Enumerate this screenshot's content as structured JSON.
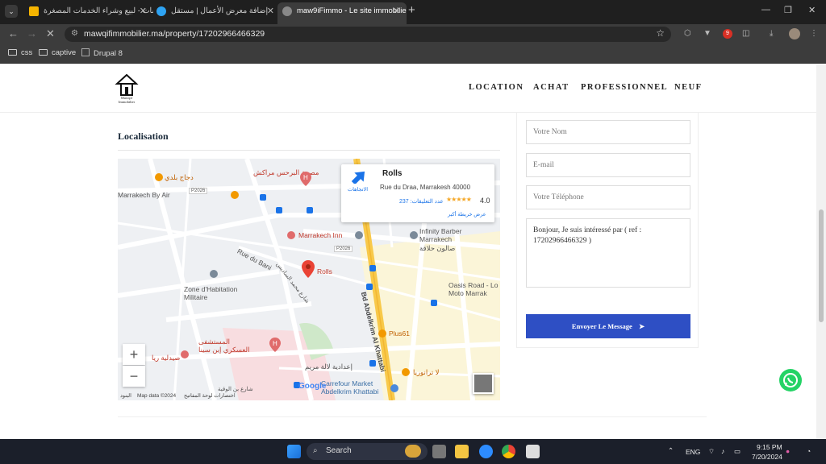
{
  "browser": {
    "tabs": [
      {
        "title": "خمسات - لبيع وشراء الخدمات المصغرة",
        "fav_color": "#f5b400"
      },
      {
        "title": "إضافة معرض الأعمال | مستقل",
        "fav_color": "#2ea3f2"
      },
      {
        "title": "maw9iFimmo - Le site immobilier",
        "fav_color": "#888888"
      }
    ],
    "url": "mawqifimmobilier.ma/property/17202966466329",
    "bookmarks": [
      "css",
      "captive",
      "Drupal 8"
    ],
    "badge_count": "9"
  },
  "site": {
    "logo_text": "Mawqif Immobilier",
    "nav": [
      "LOCATION",
      "ACHAT",
      "PROFESSIONNEL",
      "NEUF"
    ],
    "localisation_title": "Localisation"
  },
  "map": {
    "card": {
      "name": "Rolls",
      "address": "Rue du Draa, Marrakesh 40000",
      "directions": "الاتجاهات",
      "rating": "4.0",
      "reviews": "عدد التعليقات: 237",
      "larger_map": "عرض خريطة أكبر"
    },
    "labels": {
      "dajaj": "دجاج بلدي",
      "clinic": "مصحة البرحس مراكش",
      "by_air": "Marrakech By Air",
      "p2026_a": "P2026",
      "p2026_b": "P2026",
      "inn": "Marrakech Inn",
      "barber": "Infinity Barber Marrakech",
      "barber_ar": "صالون حلاقة",
      "rue_bani": "Rue du Bani",
      "rolls": "Rolls",
      "zone": "Zone d'Habitation Militaire",
      "oasis": "Oasis Road - Lo Moto Marrak",
      "abdelkrim": "Bd Abdelkrim Al Khattabi",
      "plus61": "Plus61",
      "hospital": "المستشفى العسكري إبن سينا",
      "pharmacy": "صيدلية ريا",
      "school": "إعدادية لالة مريم",
      "la_trattoria": "لا ترانوريا",
      "carrefour": "Carrefour Market Abdelkrim Khattabi",
      "road_ar": "شارع محمد الساديس",
      "ben_ar": "شارع بن الوقية"
    },
    "attrib": {
      "keys": "اختصارات لوحة المفاتيح",
      "data": "Map data ©2024",
      "terms": "البنود",
      "google": "Google"
    }
  },
  "form": {
    "name_placeholder": "Votre Nom",
    "email_placeholder": "E-mail",
    "phone_placeholder": "Votre Téléphone",
    "message": "Bonjour, Je suis intéressé par ( ref : 17202966466329 )",
    "send_label": "Envoyer Le Message"
  },
  "taskbar": {
    "search_label": "Search",
    "lang": "ENG",
    "time": "9:15 PM",
    "date": "7/20/2024"
  }
}
